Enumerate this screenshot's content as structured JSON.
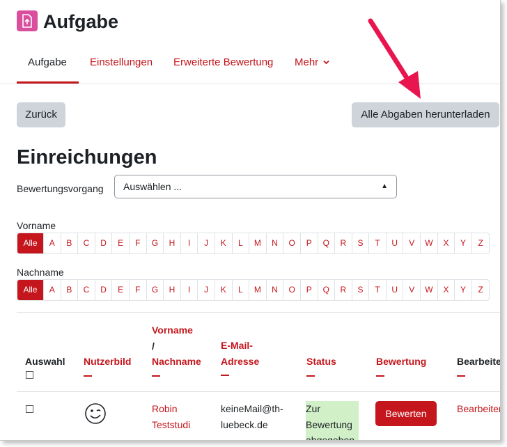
{
  "header": {
    "title": "Aufgabe",
    "icon": "assignment-upload-icon",
    "icon_color": "#d94f9d"
  },
  "tabs": [
    {
      "label": "Aufgabe",
      "active": true
    },
    {
      "label": "Einstellungen"
    },
    {
      "label": "Erweiterte Bewertung"
    },
    {
      "label": "Mehr",
      "has_dropdown": true
    }
  ],
  "buttons": {
    "back": "Zurück",
    "download_all": "Alle Abgaben herunterladen"
  },
  "section_title": "Einreichungen",
  "grading_action": {
    "label": "Bewertungsvorgang",
    "value": "Auswählen ..."
  },
  "filters": {
    "firstname_label": "Vorname",
    "lastname_label": "Nachname",
    "all_label": "Alle",
    "letters": [
      "A",
      "B",
      "C",
      "D",
      "E",
      "F",
      "G",
      "H",
      "I",
      "J",
      "K",
      "L",
      "M",
      "N",
      "O",
      "P",
      "Q",
      "R",
      "S",
      "T",
      "U",
      "V",
      "W",
      "X",
      "Y",
      "Z"
    ]
  },
  "table": {
    "headers": {
      "select": "Auswahl",
      "picture": "Nutzerbild",
      "name_1": "Vorname",
      "name_2": "/",
      "name_3": "Nachname",
      "email_1": "E-Mail-",
      "email_2": "Adresse",
      "status": "Status",
      "grade": "Bewertung",
      "edit": "Bearbeiten"
    },
    "rows": [
      {
        "first": "Robin",
        "last": "Teststudi",
        "email_1": "keineMail@th-",
        "email_2": "luebeck.de",
        "status_1": "Zur",
        "status_2": "Bewertung",
        "status_3": "abgegeben",
        "grade_button": "Bewerten",
        "edit_link": "Bearbeiten"
      }
    ]
  },
  "colors": {
    "accent": "#c4161c",
    "status_bg": "#d1f0c8",
    "button_grey": "#ced4da"
  }
}
